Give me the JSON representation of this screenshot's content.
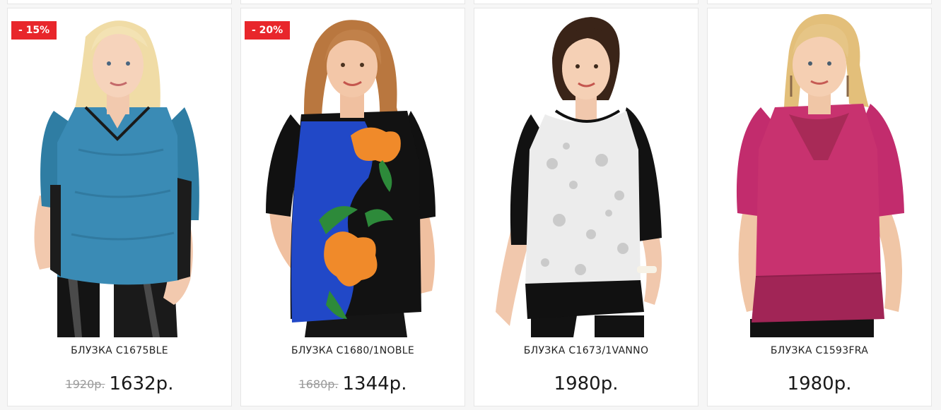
{
  "products": [
    {
      "discount_badge": "- 15%",
      "name": "БЛУЗКА С1675BLE",
      "old_price": "1920р.",
      "price": "1632р."
    },
    {
      "discount_badge": "- 20%",
      "name": "БЛУЗКА С1680/1NOBLE",
      "old_price": "1680р.",
      "price": "1344р."
    },
    {
      "discount_badge": null,
      "name": "БЛУЗКА С1673/1VANNO",
      "old_price": null,
      "price": "1980р."
    },
    {
      "discount_badge": null,
      "name": "БЛУЗКА С1593FRA",
      "old_price": null,
      "price": "1980р."
    }
  ],
  "colors": {
    "badge_red": "#e8262b",
    "price_text": "#1a1a1a",
    "old_price_text": "#9a9a9a"
  }
}
